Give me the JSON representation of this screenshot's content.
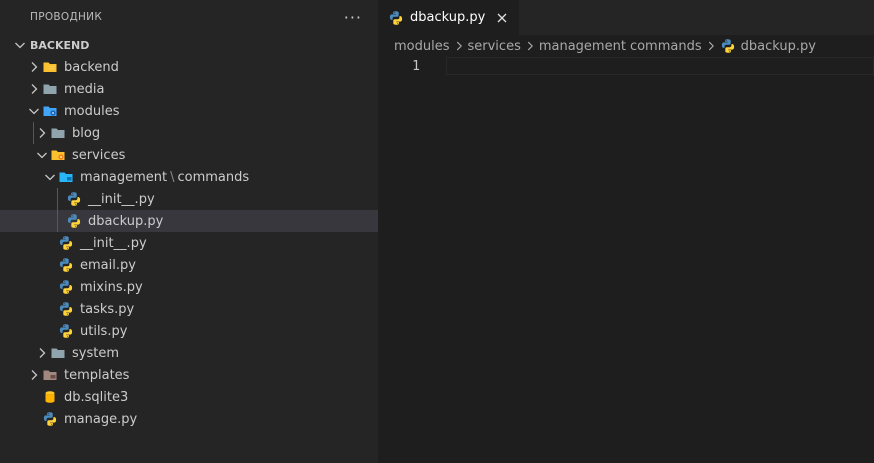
{
  "explorer": {
    "title": "ПРОВОДНИК",
    "more": "···",
    "section": "BACKEND",
    "tree": [
      {
        "label": "backend"
      },
      {
        "label": "media"
      },
      {
        "label": "modules"
      },
      {
        "label": "blog"
      },
      {
        "label": "services"
      },
      {
        "label": "management",
        "label2": "commands",
        "sep": "\\"
      },
      {
        "label": "__init__.py"
      },
      {
        "label": "dbackup.py"
      },
      {
        "label": "__init__.py"
      },
      {
        "label": "email.py"
      },
      {
        "label": "mixins.py"
      },
      {
        "label": "tasks.py"
      },
      {
        "label": "utils.py"
      },
      {
        "label": "system"
      },
      {
        "label": "templates"
      },
      {
        "label": "db.sqlite3"
      },
      {
        "label": "manage.py"
      }
    ]
  },
  "editor": {
    "tab": {
      "label": "dbackup.py"
    },
    "breadcrumb": [
      "modules",
      "services",
      "management",
      "commands",
      "dbackup.py"
    ],
    "line_numbers": [
      "1"
    ]
  },
  "colors": {
    "sidebar_bg": "#252526",
    "editor_bg": "#1e1e1e",
    "selected_row": "#37373d",
    "folder": "#90a4ae",
    "python_blue": "#3572a5",
    "python_yellow": "#ffd43b"
  }
}
